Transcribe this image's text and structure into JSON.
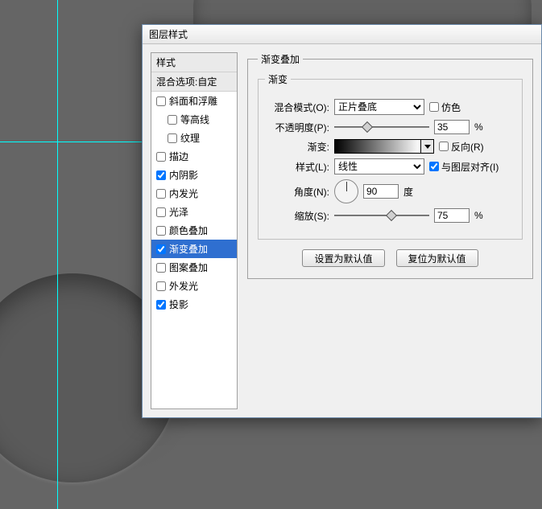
{
  "dialog": {
    "title": "图层样式"
  },
  "styles": {
    "header": "样式",
    "blend_options": "混合选项:自定",
    "items": [
      {
        "label": "斜面和浮雕",
        "checked": false
      },
      {
        "label": "等高线",
        "checked": false,
        "indent": true
      },
      {
        "label": "纹理",
        "checked": false,
        "indent": true
      },
      {
        "label": "描边",
        "checked": false
      },
      {
        "label": "内阴影",
        "checked": true
      },
      {
        "label": "内发光",
        "checked": false
      },
      {
        "label": "光泽",
        "checked": false
      },
      {
        "label": "颜色叠加",
        "checked": false
      },
      {
        "label": "渐变叠加",
        "checked": true,
        "selected": true
      },
      {
        "label": "图案叠加",
        "checked": false
      },
      {
        "label": "外发光",
        "checked": false
      },
      {
        "label": "投影",
        "checked": true
      }
    ]
  },
  "overlay": {
    "group_title": "渐变叠加",
    "sub_title": "渐变",
    "blend_mode_label": "混合模式(O):",
    "blend_mode_value": "正片叠底",
    "dither_label": "仿色",
    "dither_checked": false,
    "opacity_label": "不透明度(P):",
    "opacity_value": "35",
    "opacity_unit": "%",
    "gradient_label": "渐变:",
    "reverse_label": "反向(R)",
    "reverse_checked": false,
    "style_label": "样式(L):",
    "style_value": "线性",
    "align_label": "与图层对齐(I)",
    "align_checked": true,
    "angle_label": "角度(N):",
    "angle_value": "90",
    "angle_unit": "度",
    "scale_label": "缩放(S):",
    "scale_value": "75",
    "scale_unit": "%",
    "btn_default": "设置为默认值",
    "btn_reset": "复位为默认值"
  }
}
